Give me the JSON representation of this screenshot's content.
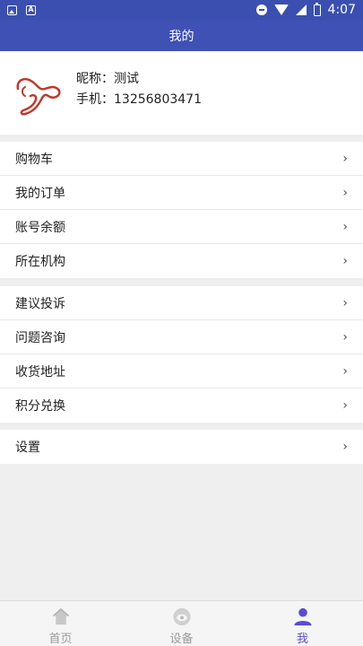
{
  "status_bar": {
    "time": "4:07",
    "notification_letter": "A"
  },
  "header": {
    "title": "我的"
  },
  "profile": {
    "nickname": "昵称：测试",
    "phone": "手机：13256803471"
  },
  "group1": [
    {
      "label": "购物车"
    },
    {
      "label": "我的订单"
    },
    {
      "label": "账号余额"
    },
    {
      "label": "所在机构"
    }
  ],
  "group2": [
    {
      "label": "建议投诉"
    },
    {
      "label": "问题咨询"
    },
    {
      "label": "收货地址"
    },
    {
      "label": "积分兑换"
    }
  ],
  "group3": [
    {
      "label": "设置"
    }
  ],
  "chevron": "›",
  "bottom_nav": [
    {
      "label": "首页",
      "icon": "home-icon"
    },
    {
      "label": "设备",
      "icon": "device-icon"
    },
    {
      "label": "我",
      "icon": "user-icon",
      "active": true
    }
  ],
  "colors": {
    "primary": "#3f51b5",
    "active_tab": "#5a4bd6"
  }
}
